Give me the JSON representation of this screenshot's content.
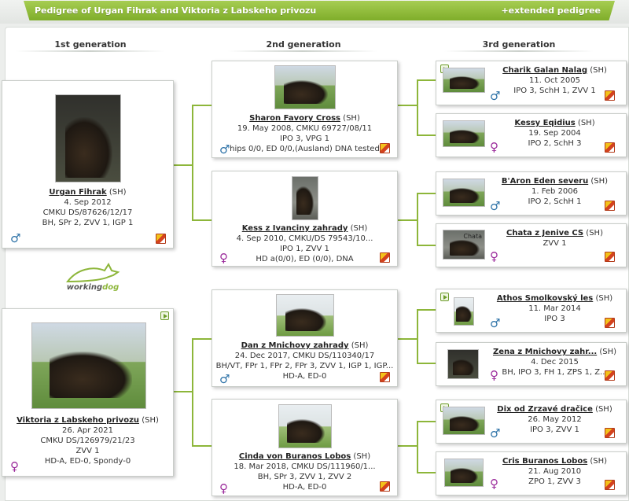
{
  "header": {
    "title": "Pedigree of Urgan Fihrak and Viktoria z Labskeho privozu",
    "extended_link": "+extended pedigree"
  },
  "generations": [
    "1st generation",
    "2nd generation",
    "3rd generation"
  ],
  "logo": {
    "word1": "working",
    "word2": "dog"
  },
  "colors": {
    "accent": "#8db63a",
    "male": "#2e73a8",
    "female": "#9b2b9b"
  },
  "gen1": [
    {
      "name": "Urgan Fihrak",
      "breed": "(SH)",
      "lines": [
        "4. Sep 2012",
        "CMKU DS/87626/12/17",
        "BH, SPr 2, ZVV 1, IGP 1"
      ],
      "gender": "♂"
    },
    {
      "name": "Viktoria z Labskeho privozu",
      "breed": "(SH)",
      "lines": [
        "26. Apr 2021",
        "CMKU DS/126979/21/23",
        "ZVV 1",
        "HD-A, ED-0, Spondy-0"
      ],
      "gender": "♀"
    }
  ],
  "gen2": [
    {
      "name": "Sharon Favory Cross",
      "breed": "(SH)",
      "lines": [
        "19. May 2008, CMKU 69727/08/11",
        "IPO 3, VPG 1",
        "hips 0/0, ED 0/0,(Ausland) DNA tested"
      ],
      "gender": "♂"
    },
    {
      "name": "Kess z Ivanciny zahrady",
      "breed": "(SH)",
      "lines": [
        "4. Sep 2010, CMKU/DS 79543/10...",
        "IPO 1, ZVV 1",
        "HD a(0/0), ED (0/0), DNA"
      ],
      "gender": "♀"
    },
    {
      "name": "Dan z Mnichovy zahrady",
      "breed": "(SH)",
      "lines": [
        "24. Dec 2017, CMKU DS/110340/17",
        "BH/VT, FPr 1, FPr 2, FPr 3, ZVV 1, IGP 1, IGP...",
        "HD-A, ED-0"
      ],
      "gender": "♂"
    },
    {
      "name": "Cinda von Buranos Lobos",
      "breed": "(SH)",
      "lines": [
        "18. Mar 2018, CMKU DS/111960/1...",
        "BH, SPr 3, ZVV 1, ZVV 2",
        "HD-A, ED-0"
      ],
      "gender": "♀"
    }
  ],
  "gen3": [
    {
      "name": "Charik Galan Nalag",
      "breed": "(SH)",
      "lines": [
        "11. Oct 2005",
        "IPO 3, SchH 1, ZVV 1"
      ],
      "gender": "♂"
    },
    {
      "name": "Kessy Eqidius",
      "breed": "(SH)",
      "lines": [
        "19. Sep 2004",
        "IPO 2, SchH 3"
      ],
      "gender": "♀"
    },
    {
      "name": "B'Aron Eden severu",
      "breed": "(SH)",
      "lines": [
        "1. Feb 2006",
        "IPO 2, SchH 1"
      ],
      "gender": "♂"
    },
    {
      "name": "Chata z Jenive CS",
      "breed": "(SH)",
      "lines": [
        "ZVV 1"
      ],
      "gender": "♀",
      "photo_caption": "Chata"
    },
    {
      "name": "Athos Smolkovský les",
      "breed": "(SH)",
      "lines": [
        "11. Mar 2014",
        "IPO 3"
      ],
      "gender": "♂"
    },
    {
      "name": "Zena z Mnichovy zahr...",
      "breed": "(SH)",
      "lines": [
        "4. Dec 2015",
        "BH, IPO 3, FH 1, ZPS 1, Z..."
      ],
      "gender": "♀"
    },
    {
      "name": "Dix od Zrzavé dračice",
      "breed": "(SH)",
      "lines": [
        "26. May 2012",
        "IPO 3, ZVV 1"
      ],
      "gender": "♂"
    },
    {
      "name": "Cris Buranos Lobos",
      "breed": "(SH)",
      "lines": [
        "21. Aug 2010",
        "ZPO 1, ZVV 3"
      ],
      "gender": "♀"
    }
  ]
}
